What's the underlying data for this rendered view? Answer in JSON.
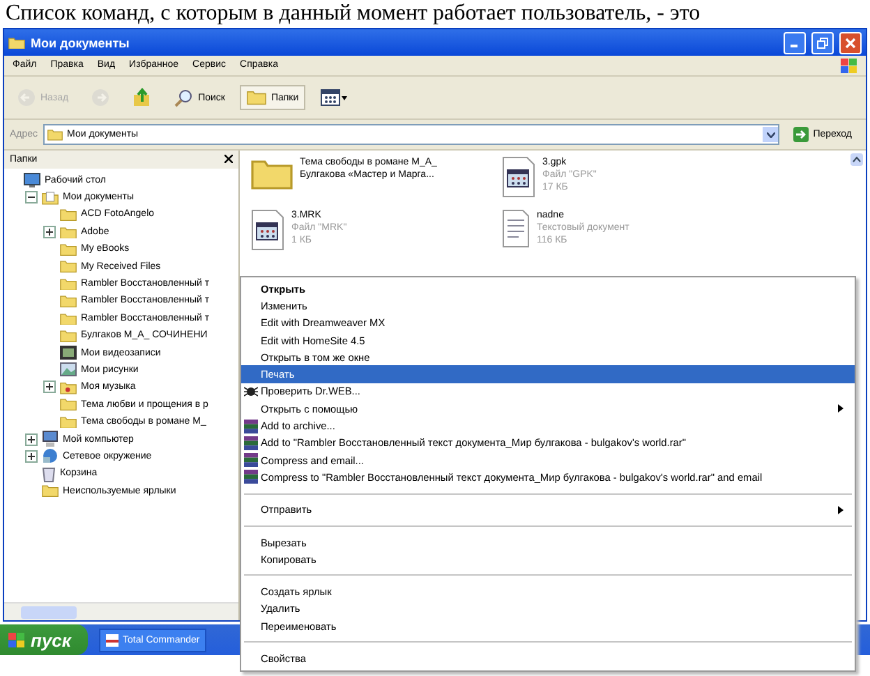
{
  "caption": "Список команд, с которым в данный момент работает пользователь, - это",
  "window": {
    "title": "Мои документы"
  },
  "menu_bar": [
    "Файл",
    "Правка",
    "Вид",
    "Избранное",
    "Сервис",
    "Справка"
  ],
  "toolbar": {
    "buttons": [
      {
        "kind": "back",
        "label": "Назад",
        "disabled": true,
        "selected": false
      },
      {
        "kind": "forward",
        "disabled": true,
        "selected": false
      },
      {
        "kind": "up",
        "disabled": false,
        "selected": false
      },
      {
        "kind": "search",
        "label": "Поиск",
        "disabled": false,
        "selected": false
      },
      {
        "kind": "folders",
        "label": "Папки",
        "disabled": false,
        "selected": true
      },
      {
        "kind": "views",
        "disabled": false,
        "selected": false
      }
    ]
  },
  "address_bar": {
    "label": "Адрес",
    "value": "Мои документы",
    "go": "Переход"
  },
  "folders_pane": {
    "title": "Папки",
    "tree": [
      {
        "label": "Рабочий стол",
        "kind": "desktop",
        "children": [
          {
            "label": "Мои документы",
            "kind": "documents",
            "expanded": true,
            "children": [
              {
                "label": "ACD FotoAngelo",
                "kind": "folder"
              },
              {
                "label": "Adobe",
                "kind": "folder",
                "expanded": false
              },
              {
                "label": "My eBooks",
                "kind": "folder"
              },
              {
                "label": "My Received Files",
                "kind": "folder"
              },
              {
                "label": "Rambler Восстановленный т",
                "kind": "folder"
              },
              {
                "label": "Rambler Восстановленный т",
                "kind": "folder"
              },
              {
                "label": "Rambler Восстановленный т",
                "kind": "folder"
              },
              {
                "label": "Булгаков М_А_ СОЧИНЕНИ",
                "kind": "folder"
              },
              {
                "label": "Мои видеозаписи",
                "kind": "video"
              },
              {
                "label": "Мои рисунки",
                "kind": "pictures"
              },
              {
                "label": "Моя музыка",
                "kind": "music",
                "expanded": false
              },
              {
                "label": "Тема любви и прощения в р",
                "kind": "folder"
              },
              {
                "label": "Тема свободы в романе М_",
                "kind": "folder"
              }
            ]
          },
          {
            "label": "Мой компьютер",
            "kind": "computer",
            "expanded": false
          },
          {
            "label": "Сетевое окружение",
            "kind": "network",
            "expanded": false
          },
          {
            "label": "Корзина",
            "kind": "trash"
          },
          {
            "label": "Неиспользуемые ярлыки",
            "kind": "folder"
          }
        ]
      }
    ]
  },
  "files": [
    {
      "kind": "folder",
      "name": "Тема свободы в романе М_А_ Булгакова «Мастер и Марга..."
    },
    {
      "kind": "app",
      "name": "3.gpk",
      "type": "Файл \"GPK\"",
      "size": "17 КБ"
    },
    {
      "kind": "app",
      "name": "3.MRK",
      "type": "Файл \"MRK\"",
      "size": "1 КБ"
    },
    {
      "kind": "text",
      "name": "nadne",
      "type": "Текстовый документ",
      "size": "116 КБ"
    }
  ],
  "context_menu": {
    "items": [
      {
        "kind": "item",
        "label": "Открыть",
        "bold": true,
        "selected": false,
        "submenu": false
      },
      {
        "kind": "item",
        "label": "Изменить",
        "bold": false,
        "selected": false,
        "submenu": false
      },
      {
        "kind": "item",
        "label": "Edit with Dreamweaver MX",
        "bold": false,
        "selected": false,
        "submenu": false
      },
      {
        "kind": "item",
        "label": "Edit with HomeSite 4.5",
        "bold": false,
        "selected": false,
        "submenu": false
      },
      {
        "kind": "item",
        "label": "Открыть в том же окне",
        "bold": false,
        "selected": false,
        "submenu": false
      },
      {
        "kind": "item",
        "label": "Печать",
        "bold": false,
        "selected": true,
        "submenu": false
      },
      {
        "kind": "antivirus",
        "label": "Проверить Dr.WEB...",
        "bold": false,
        "selected": false,
        "submenu": false
      },
      {
        "kind": "item",
        "label": "Открыть с помощью",
        "bold": false,
        "selected": false,
        "submenu": true
      },
      {
        "kind": "archiver",
        "label": "Add to archive...",
        "bold": false,
        "selected": false,
        "submenu": false
      },
      {
        "kind": "archiver",
        "label": "Add to \"Rambler Восстановленный текст документа_Мир булгакова - bulgakov's world.rar\"",
        "bold": false,
        "selected": false,
        "submenu": false
      },
      {
        "kind": "archiver",
        "label": "Compress and email...",
        "bold": false,
        "selected": false,
        "submenu": false
      },
      {
        "kind": "archiver",
        "label": "Compress to \"Rambler Восстановленный текст документа_Мир булгакова - bulgakov's world.rar\" and email",
        "bold": false,
        "selected": false,
        "submenu": false
      },
      {
        "kind": "separator"
      },
      {
        "kind": "item",
        "label": "Отправить",
        "bold": false,
        "selected": false,
        "submenu": true
      },
      {
        "kind": "separator"
      },
      {
        "kind": "item",
        "label": "Вырезать",
        "bold": false,
        "selected": false,
        "submenu": false
      },
      {
        "kind": "item",
        "label": "Копировать",
        "bold": false,
        "selected": false,
        "submenu": false
      },
      {
        "kind": "separator"
      },
      {
        "kind": "item",
        "label": "Создать ярлык",
        "bold": false,
        "selected": false,
        "submenu": false
      },
      {
        "kind": "item",
        "label": "Удалить",
        "bold": false,
        "selected": false,
        "submenu": false
      },
      {
        "kind": "item",
        "label": "Переименовать",
        "bold": false,
        "selected": false,
        "submenu": false
      },
      {
        "kind": "separator"
      },
      {
        "kind": "item",
        "label": "Свойства",
        "bold": false,
        "selected": false,
        "submenu": false
      }
    ]
  },
  "taskbar": {
    "start": "пуск",
    "tasks": [
      "Total Commander"
    ]
  }
}
